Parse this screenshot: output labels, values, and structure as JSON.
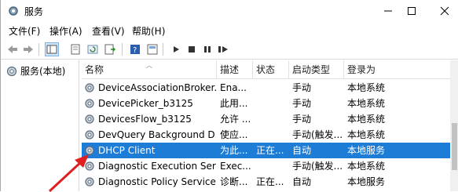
{
  "window": {
    "title": "服务"
  },
  "menu": [
    "文件(F)",
    "操作(A)",
    "查看(V)",
    "帮助(H)"
  ],
  "tree": {
    "label": "服务(本地)"
  },
  "columns": [
    "名称",
    "描述",
    "状态",
    "启动类型",
    "登录为"
  ],
  "rows": [
    {
      "name": "DeviceAssociationBroker...",
      "desc": "Ena...",
      "status": "",
      "startup": "手动",
      "logon": "本地系统",
      "selected": false
    },
    {
      "name": "DevicePicker_b3125",
      "desc": "此用...",
      "status": "",
      "startup": "手动",
      "logon": "本地系统",
      "selected": false
    },
    {
      "name": "DevicesFlow_b3125",
      "desc": "允许 ...",
      "status": "",
      "startup": "手动",
      "logon": "本地系统",
      "selected": false
    },
    {
      "name": "DevQuery Background D...",
      "desc": "使应...",
      "status": "",
      "startup": "手动(触发...",
      "logon": "本地系统",
      "selected": false
    },
    {
      "name": "DHCP Client",
      "desc": "为此...",
      "status": "正在...",
      "startup": "自动",
      "logon": "本地服务",
      "selected": true
    },
    {
      "name": "Diagnostic Execution Ser...",
      "desc": "Exec...",
      "status": "",
      "startup": "手动(触发...",
      "logon": "本地系统",
      "selected": false
    },
    {
      "name": "Diagnostic Policy Service",
      "desc": "诊断...",
      "status": "正在...",
      "startup": "自动",
      "logon": "本地服务",
      "selected": false
    }
  ],
  "colors": {
    "selection": "#1c7cd6",
    "annotation_arrow": "#e02020"
  }
}
